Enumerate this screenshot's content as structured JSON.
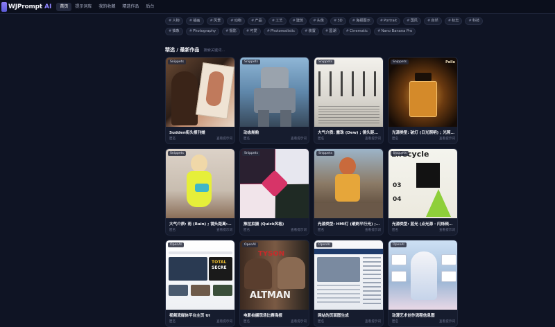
{
  "brand": {
    "name": "WJPrompt",
    "suffix": "AI"
  },
  "nav": [
    "首页",
    "提示词库",
    "我的收藏",
    "精选作品",
    "后台"
  ],
  "tags_row1": [
    "人物",
    "插画",
    "风景",
    "动物",
    "产品",
    "工艺",
    "建筑",
    "头像",
    "3D",
    "海报图示",
    "Portrait",
    "国风",
    "自然",
    "标志",
    "科技"
  ],
  "tags_row2": [
    "抽象",
    "Photography",
    "摄影",
    "可爱",
    "Photorealistic",
    "装置",
    "国潮",
    "Cinematic",
    "Nano Banana Pro"
  ],
  "section": {
    "title": "精选 / 最新作品",
    "search_placeholder": "搜索关键词..."
  },
  "cards": [
    {
      "badge": "Snippets",
      "title": "Sudden街头报刊摊",
      "author": "匿名",
      "action": "查看提示词"
    },
    {
      "badge": "Snippets",
      "title": "动态舱舱",
      "author": "匿名",
      "action": "查看提示词"
    },
    {
      "badge": "Snippets",
      "title": "大气介质: 露珠 (Dew) ; 镜头距离: ...",
      "author": "匿名",
      "action": "查看提示词"
    },
    {
      "badge": "Snippets",
      "title": "光源类型: 破灯 (日光照明) ; 光照: ...",
      "author": "匿名",
      "action": "查看提示词"
    },
    {
      "badge": "Snippets",
      "title": "大气介质: 雨 (Rain) ; 镜头距离: 镜...",
      "author": "匿名",
      "action": "查看提示词"
    },
    {
      "badge": "Snippets",
      "title": "推拉拍摄 (Quick风格)",
      "author": "匿名",
      "action": "查看提示词"
    },
    {
      "badge": "Snippets",
      "title": "光源类型: HMI灯 (硬刷平行光) ; ...",
      "author": "匿名",
      "action": "查看提示词"
    },
    {
      "badge": "Snippets",
      "title": "光源类型: 蓝光 (点光源 · 闪烁频率...",
      "author": "匿名",
      "action": "查看提示词"
    },
    {
      "badge": "OpenAI",
      "title": "视频流媒体平台主页 UI",
      "author": "匿名",
      "action": "查看提示词"
    },
    {
      "badge": "OpenAI",
      "title": "电影拍摄现场比赛海报",
      "author": "匿名",
      "action": "查看提示词"
    },
    {
      "badge": "OpenAI",
      "title": "网站的页面图生成",
      "author": "匿名",
      "action": "查看提示词"
    },
    {
      "badge": "OpenAI",
      "title": "动漫艺术创作流程信息图",
      "author": "匿名",
      "action": "查看提示词"
    }
  ],
  "art_text": {
    "card4_brand": "Pelle",
    "card8_heading": "Lifecycle",
    "card8_num1": "03",
    "card8_num2": "04",
    "card9_headline1": "TOTAL",
    "card9_headline2": "SECRE",
    "card10_top": "TYSON",
    "card10_name": "ALTMAN"
  }
}
